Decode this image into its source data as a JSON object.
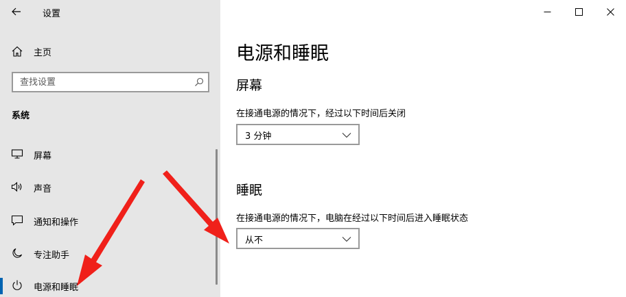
{
  "window": {
    "title": "设置",
    "minimize_icon": "minimize-icon",
    "maximize_icon": "maximize-icon",
    "close_icon": "close-icon"
  },
  "sidebar": {
    "home_label": "主页",
    "search_placeholder": "查找设置",
    "section_label": "系统",
    "items": [
      {
        "label": "屏幕",
        "icon": "monitor-icon"
      },
      {
        "label": "声音",
        "icon": "speaker-icon"
      },
      {
        "label": "通知和操作",
        "icon": "notification-icon"
      },
      {
        "label": "专注助手",
        "icon": "moon-icon"
      },
      {
        "label": "电源和睡眠",
        "icon": "power-icon",
        "active": true
      }
    ]
  },
  "main": {
    "title": "电源和睡眠",
    "screen": {
      "heading": "屏幕",
      "description": "在接通电源的情况下，经过以下时间后关闭",
      "selected": "3 分钟"
    },
    "sleep": {
      "heading": "睡眠",
      "description": "在接通电源的情况下，电脑在经过以下时间后进入睡眠状态",
      "selected": "从不"
    }
  },
  "colors": {
    "sidebar_bg": "#e6e6e6",
    "accent": "#0063b1",
    "annotation_arrow": "#f0201a"
  }
}
